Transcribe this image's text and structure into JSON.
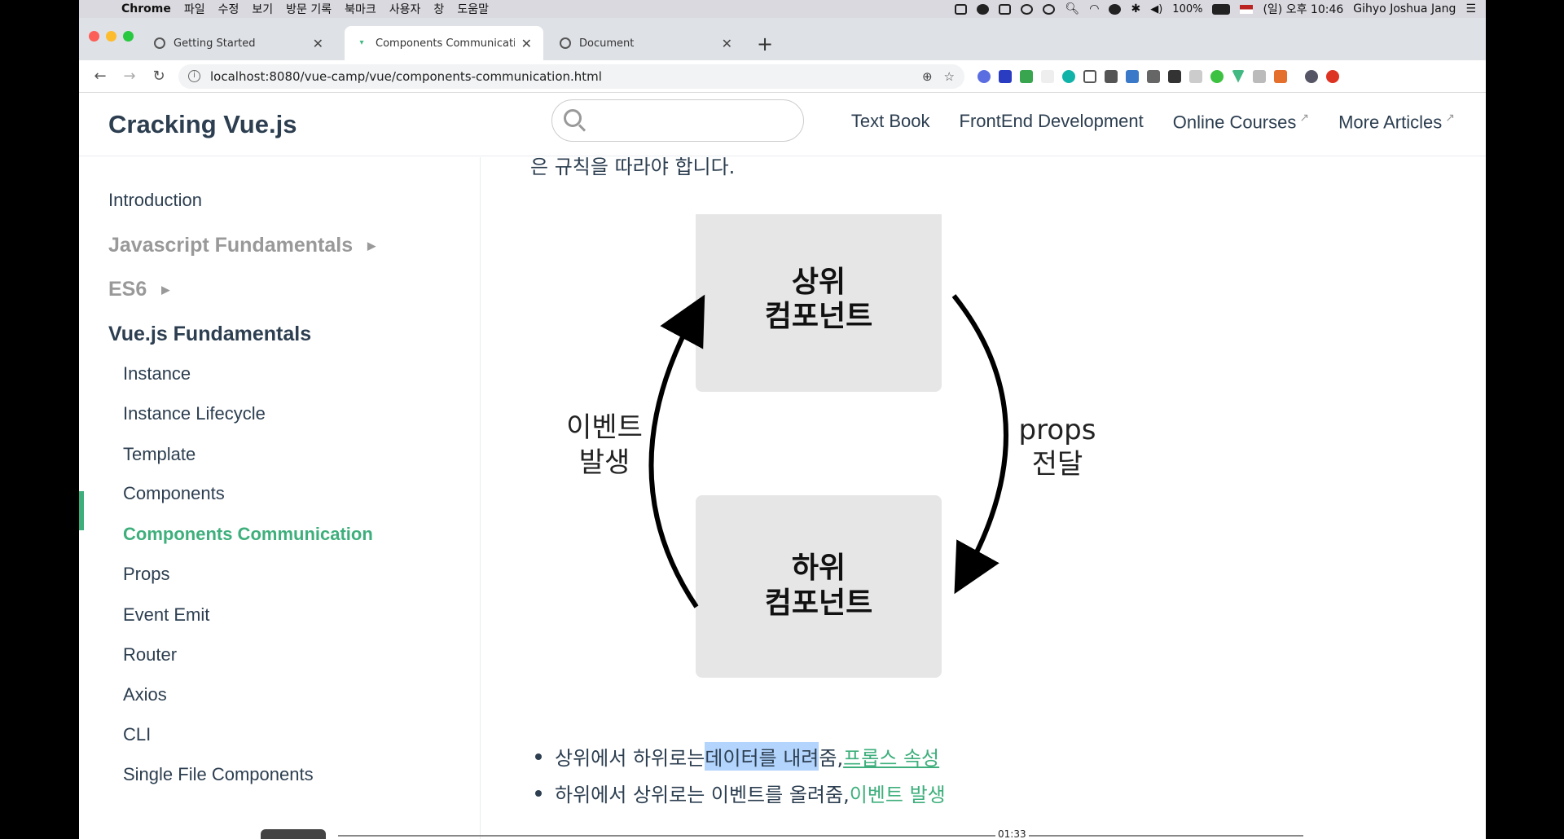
{
  "menubar": {
    "app": "Chrome",
    "menus": [
      "파일",
      "수정",
      "보기",
      "방문 기록",
      "북마크",
      "사용자",
      "창",
      "도움말"
    ],
    "battery": "100%",
    "datetime": "(일) 오후 10:46",
    "user": "Gihyo Joshua Jang"
  },
  "tabs": [
    {
      "label": "Getting Started",
      "active": false
    },
    {
      "label": "Components Communication |",
      "active": true
    },
    {
      "label": "Document",
      "active": false
    }
  ],
  "address": {
    "url": "localhost:8080/vue-camp/vue/components-communication.html"
  },
  "site": {
    "title": "Cracking Vue.js",
    "search_placeholder": "",
    "nav": [
      "Text Book",
      "FrontEnd Development",
      "Online Courses",
      "More Articles"
    ]
  },
  "sidebar": {
    "introduction": "Introduction",
    "group_js": "Javascript Fundamentals",
    "group_es6": "ES6",
    "group_vue": "Vue.js Fundamentals",
    "items": [
      "Instance",
      "Instance Lifecycle",
      "Template",
      "Components",
      "Components Communication",
      "Props",
      "Event Emit",
      "Router",
      "Axios",
      "CLI",
      "Single File Components"
    ],
    "current": "Components Communication"
  },
  "content": {
    "top_text": "은 규칙을 따라야 합니다.",
    "diagram": {
      "parent": [
        "상위",
        "컴포넌트"
      ],
      "child": [
        "하위",
        "컴포넌트"
      ],
      "left_label": [
        "이벤트",
        "발생"
      ],
      "right_label": [
        "props",
        "전달"
      ]
    },
    "bullet1": {
      "prefix": "상위에서 하위로는 ",
      "highlight": "데이터를 내려",
      "middle": "줌, ",
      "link": "프롭스 속성"
    },
    "bullet2": {
      "prefix": "하위에서 상위로는 이벤트를 올려줌, ",
      "link": "이벤트 발생"
    }
  },
  "video": {
    "time": "01:33"
  }
}
